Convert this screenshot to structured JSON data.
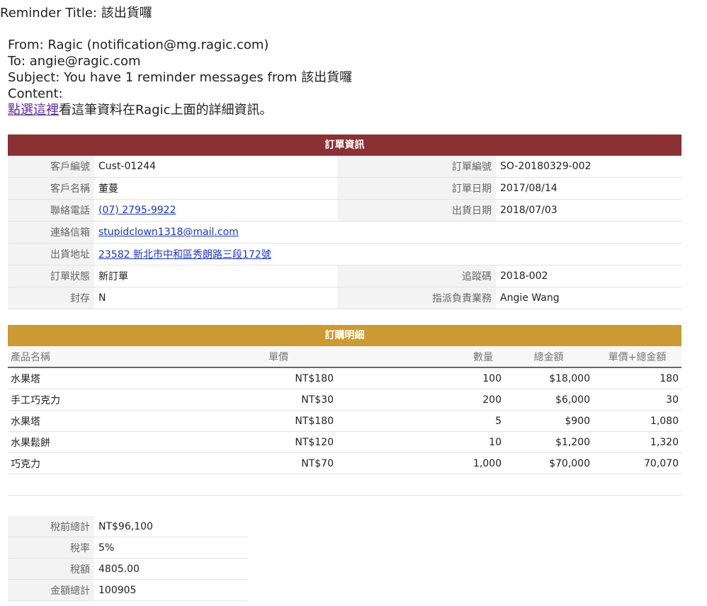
{
  "reminder": {
    "label": "Reminder Title: ",
    "title": "該出貨囉"
  },
  "email": {
    "from": "From: Ragic (notification@mg.ragic.com)",
    "to": "To: angie@ragic.com",
    "subject": "Subject: You have 1 reminder messages from 該出貨囉",
    "content_label": "Content:",
    "link_text": "點選這裡",
    "link_suffix": "看這筆資料在Ragic上面的詳細資訊。"
  },
  "order": {
    "header": "訂單資訊",
    "rows": [
      {
        "l1": "客戶編號",
        "v1": "Cust-01244",
        "l2": "訂單編號",
        "v2": "SO-20180329-002"
      },
      {
        "l1": "客戶名稱",
        "v1": "董蔓",
        "l2": "訂單日期",
        "v2": "2017/08/14"
      },
      {
        "l1": "聯絡電話",
        "v1": "(07) 2795-9922",
        "l2": "出貨日期",
        "v2": "2018/07/03"
      },
      {
        "l1": "連絡信箱",
        "v1": "stupidclown1318@mail.com"
      },
      {
        "l1": "出貨地址",
        "v1": "23582 新北市中和區秀朗路三段172號"
      },
      {
        "l1": "訂單狀態",
        "v1": "新訂單",
        "l2": "追蹤碼",
        "v2": "2018-002"
      },
      {
        "l1": "封存",
        "v1": "N",
        "l2": "指派負責業務",
        "v2": "Angie Wang"
      }
    ]
  },
  "items": {
    "header": "訂購明細",
    "columns": [
      "產品名稱",
      "單價",
      "數量",
      "總金額",
      "單價+總金額"
    ],
    "rows": [
      [
        "水果塔",
        "NT$180",
        "100",
        "$18,000",
        "180"
      ],
      [
        "手工巧克力",
        "NT$30",
        "200",
        "$6,000",
        "30"
      ],
      [
        "水果塔",
        "NT$180",
        "5",
        "$900",
        "1,080"
      ],
      [
        "水果鬆餅",
        "NT$120",
        "10",
        "$1,200",
        "1,320"
      ],
      [
        "巧克力",
        "NT$70",
        "1,000",
        "$70,000",
        "70,070"
      ]
    ]
  },
  "summary": {
    "rows": [
      {
        "label": "稅前總計",
        "value": "NT$96,100"
      },
      {
        "label": "稅率",
        "value": "5%"
      },
      {
        "label": "稅額",
        "value": "4805.00"
      },
      {
        "label": "金額總計",
        "value": "100905"
      }
    ]
  },
  "colors": {
    "order_header": "#8b3033",
    "items_header": "#cc9a32",
    "link": "#1a35cc"
  }
}
